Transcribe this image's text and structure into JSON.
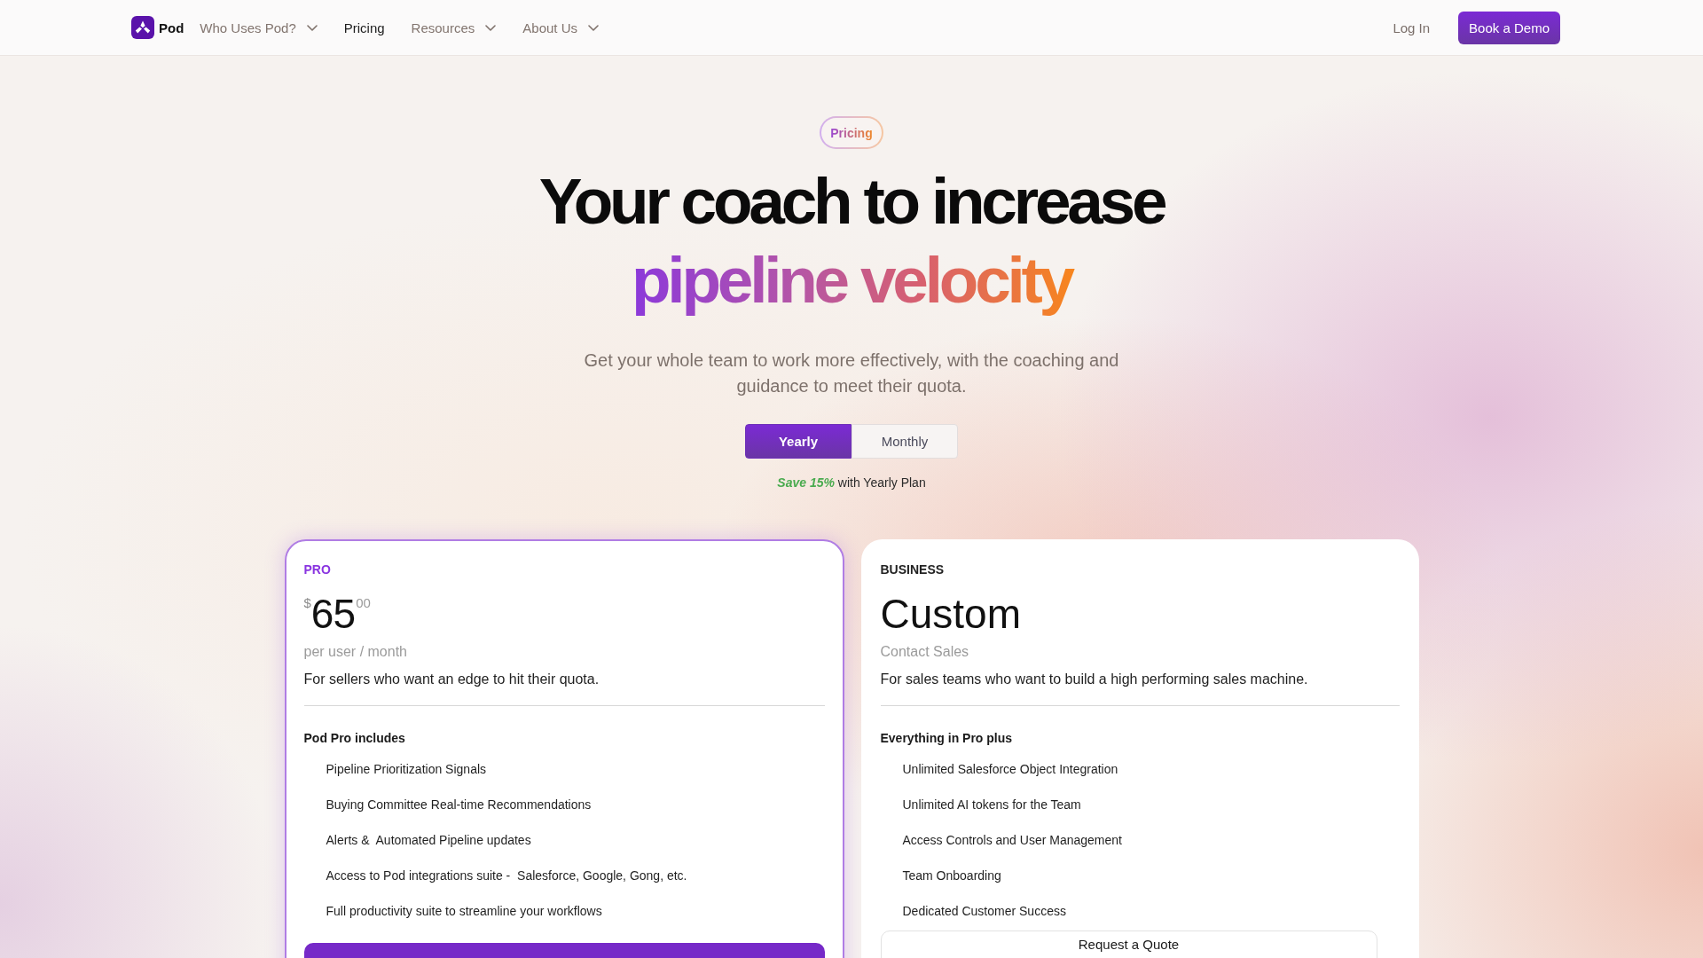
{
  "nav": {
    "brand": "Pod",
    "items": [
      {
        "label": "Who Uses Pod?",
        "dropdown": true,
        "selected": false
      },
      {
        "label": "Pricing",
        "dropdown": false,
        "selected": true
      },
      {
        "label": "Resources",
        "dropdown": true,
        "selected": false
      },
      {
        "label": "About Us",
        "dropdown": true,
        "selected": false
      }
    ],
    "login": "Log In",
    "cta": "Book a Demo"
  },
  "hero": {
    "badge": "Pricing",
    "headline": "Your coach to increase",
    "headline_highlight": "pipeline velocity",
    "subtitle": "Get your whole team to work more effectively, with the coaching and guidance to meet their quota.",
    "billing_toggle": [
      {
        "label": "Yearly",
        "selected": true
      },
      {
        "label": "Monthly",
        "selected": false
      }
    ],
    "savings_note": "**Save 15%** with Yearly Plan"
  },
  "plans": [
    {
      "kind": "priced",
      "name": "PRO",
      "featured": true,
      "currency": "$",
      "price": "65",
      "cents": "00",
      "price_note": "per user / month",
      "description": "For sellers who want an edge to hit their quota.",
      "features_title": "Pod Pro includes",
      "features": [
        "Pipeline Prioritization Signals",
        "Buying Committee Real-time Recommendations",
        "Alerts &  Automated Pipeline updates",
        "Access to Pod integrations suite -  Salesforce, Google, Gong, etc.",
        "Full productivity suite to streamline your workflows"
      ],
      "button": {
        "kind": "filled"
      }
    },
    {
      "kind": "custom",
      "name": "BUSINESS",
      "featured": false,
      "price": "Custom",
      "price_note": "Contact Sales",
      "description": "For sales teams who want to build a high performing sales machine.",
      "features_title": "Everything in Pro plus",
      "features": [
        "Unlimited Salesforce Object Integration",
        "Unlimited AI tokens for the Team",
        "Access Controls and User Management",
        "Team Onboarding",
        "Dedicated Customer Success"
      ],
      "button": {
        "kind": "outline",
        "label": "Request a Quote"
      }
    }
  ]
}
